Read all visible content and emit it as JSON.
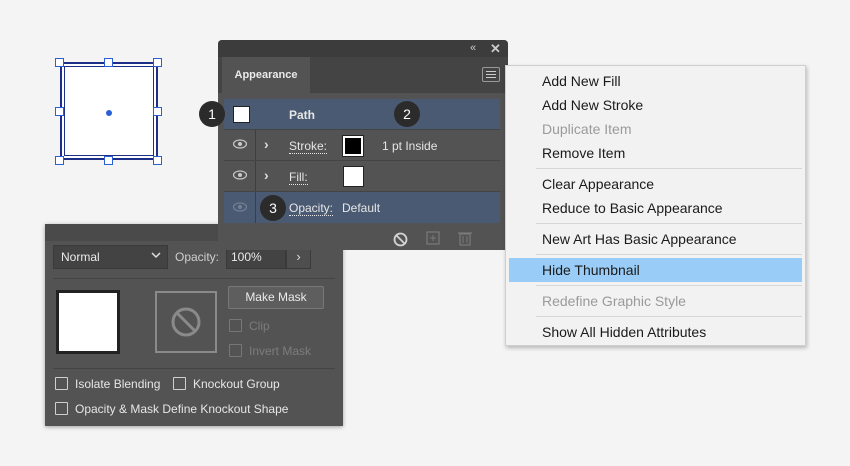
{
  "appearance": {
    "tab_label": "Appearance",
    "rows": {
      "path_label": "Path",
      "stroke_label": "Stroke:",
      "stroke_value": "1 pt  Inside",
      "fill_label": "Fill:",
      "opacity_label": "Opacity:",
      "opacity_value": "Default"
    },
    "callouts": [
      "1",
      "2",
      "3"
    ]
  },
  "context_menu": {
    "items": [
      {
        "label": "Add New Fill",
        "enabled": true
      },
      {
        "label": "Add New Stroke",
        "enabled": true
      },
      {
        "label": "Duplicate Item",
        "enabled": false
      },
      {
        "label": "Remove Item",
        "enabled": true
      },
      {
        "label": "Clear Appearance",
        "enabled": true
      },
      {
        "label": "Reduce to Basic Appearance",
        "enabled": true
      },
      {
        "label": "New Art Has Basic Appearance",
        "enabled": true
      },
      {
        "label": "Hide Thumbnail",
        "enabled": true,
        "highlighted": true
      },
      {
        "label": "Redefine Graphic Style",
        "enabled": false
      },
      {
        "label": "Show All Hidden Attributes",
        "enabled": true
      }
    ]
  },
  "transparency": {
    "blend_mode": "Normal",
    "opacity_label": "Opacity:",
    "opacity_value": "100%",
    "make_mask_label": "Make Mask",
    "clip_label": "Clip",
    "invert_mask_label": "Invert Mask",
    "isolate_blending_label": "Isolate Blending",
    "knockout_group_label": "Knockout Group",
    "opacity_mask_knockout_label": "Opacity & Mask Define Knockout Shape"
  },
  "icons": {
    "eye": "eye-icon",
    "chevron": "chevron-right-icon",
    "menu": "hamburger-menu-icon",
    "collapse": "double-chevron-left-icon",
    "close": "close-icon",
    "clear": "no-entry-icon",
    "duplicate": "duplicate-icon",
    "delete": "trash-icon"
  },
  "colors": {
    "highlight": "#99ccf6",
    "selection_row": "#4a5a72",
    "panel_bg": "#535353",
    "selection_blue": "#2a5fd6"
  }
}
